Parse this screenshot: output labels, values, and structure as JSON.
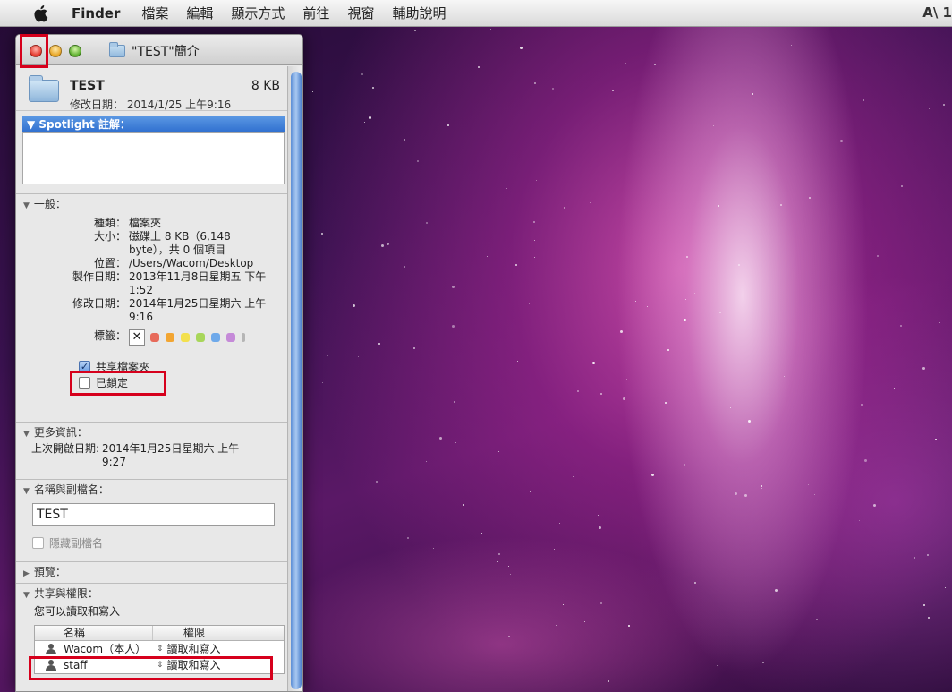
{
  "menubar": {
    "app_name": "Finder",
    "menus": [
      "檔案",
      "編輯",
      "顯示方式",
      "前往",
      "視窗",
      "輔助說明"
    ],
    "right_text": "A\\ 1"
  },
  "window": {
    "title": "\"TEST\"簡介"
  },
  "header": {
    "name": "TEST",
    "size": "8 KB",
    "modified": "修改日期： 2014/1/25 上午9:16"
  },
  "spotlight": {
    "title": "▼ Spotlight 註解："
  },
  "general": {
    "title": "一般：",
    "rows": [
      {
        "label": "種類：",
        "value": "檔案夾"
      },
      {
        "label": "大小：",
        "value": "磁碟上 8 KB（6,148 byte），共 0 個項目"
      },
      {
        "label": "位置：",
        "value": "/Users/Wacom/Desktop"
      },
      {
        "label": "製作日期：",
        "value": "2013年11月8日星期五 下午1:52"
      },
      {
        "label": "修改日期：",
        "value": "2014年1月25日星期六 上午9:16"
      }
    ],
    "tags_label": "標籤：",
    "tag_x": "✕",
    "tag_colors": [
      "#e76a5a",
      "#f2a531",
      "#f3e04d",
      "#a8d65a",
      "#6ea9ea",
      "#c58ad8",
      "#b5b5b5"
    ],
    "shared_label": "共享檔案夾",
    "shared_checked": true,
    "locked_label": "已鎖定",
    "locked_checked": false
  },
  "more_info": {
    "title": "更多資訊：",
    "last_opened_label": "上次開啟日期:",
    "last_opened_value": "2014年1月25日星期六 上午9:27"
  },
  "name_ext": {
    "title": "名稱與副檔名：",
    "name_value": "TEST",
    "hide_ext_label": "隱藏副檔名"
  },
  "preview": {
    "title": "預覽："
  },
  "sharing": {
    "title": "共享與權限：",
    "note": "您可以讀取和寫入",
    "col_name": "名稱",
    "col_perm": "權限",
    "rows": [
      {
        "name": "Wacom（本人）",
        "perm": "讀取和寫入"
      },
      {
        "name": "staff",
        "perm": "讀取和寫入"
      }
    ]
  }
}
